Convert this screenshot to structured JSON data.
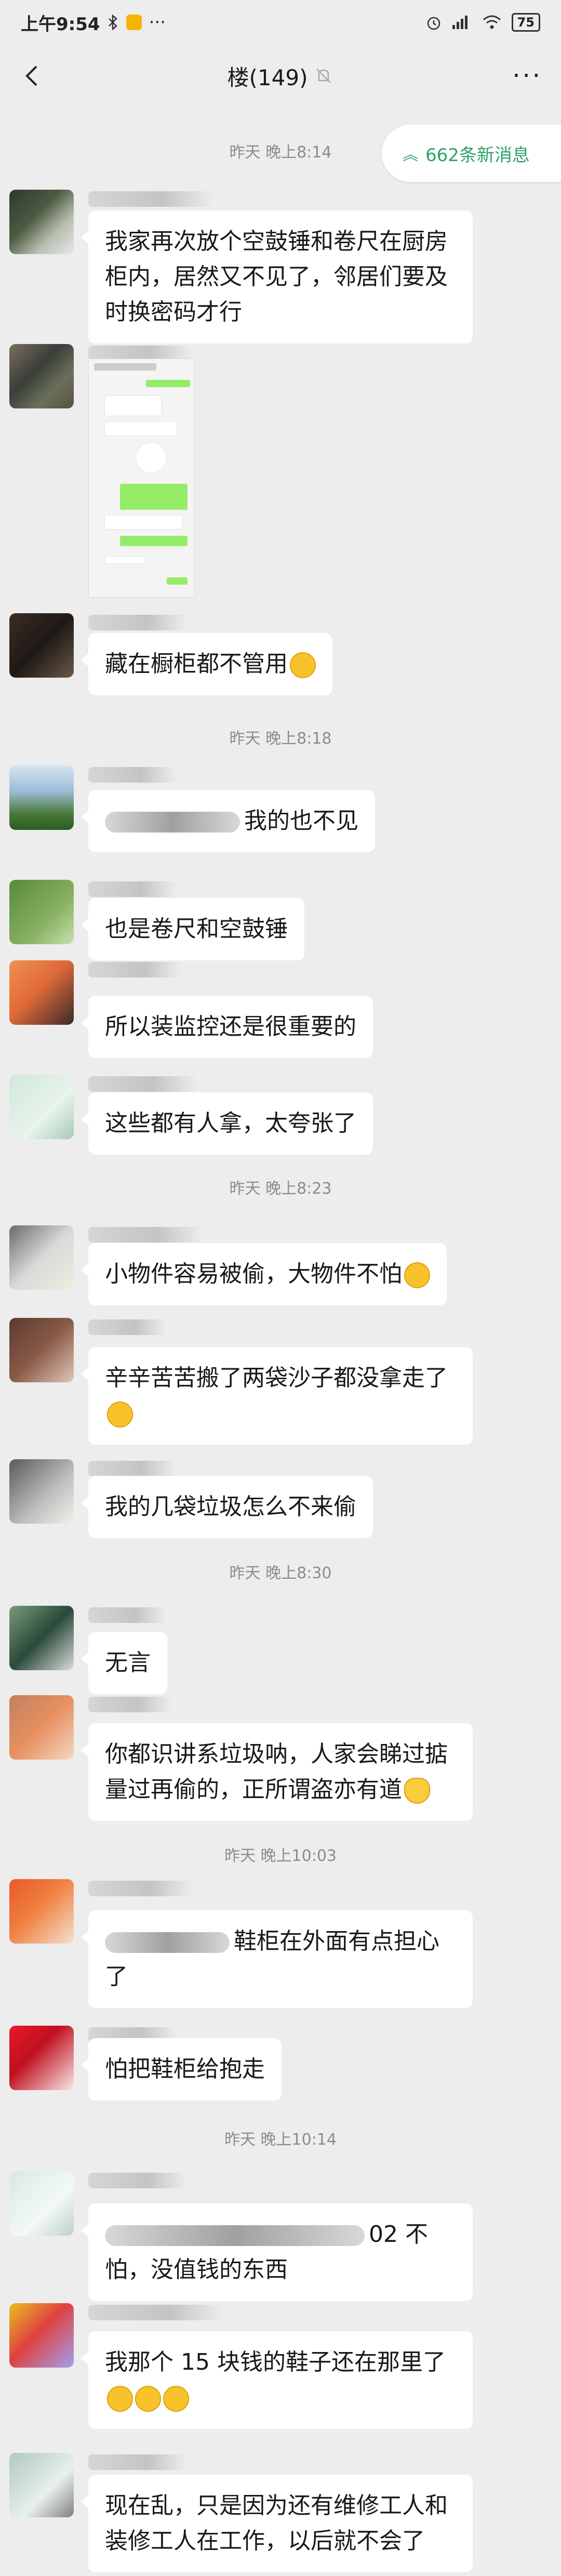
{
  "status_bar": {
    "time": "上午9:54",
    "battery": "75"
  },
  "header": {
    "title": "楼(149)",
    "more": "···"
  },
  "new_messages": "662条新消息",
  "timestamps": {
    "t1": "昨天 晚上8:14",
    "t2": "昨天 晚上8:18",
    "t3": "昨天 晚上8:23",
    "t4": "昨天 晚上8:30",
    "t5": "昨天 晚上10:03",
    "t6": "昨天 晚上10:14"
  },
  "messages": {
    "m1": "我家再次放个空鼓锤和卷尺在厨房柜内，居然又不见了，邻居们要及时换密码才行",
    "m2": "藏在橱柜都不管用",
    "m3": "我的也不见",
    "m4": "也是卷尺和空鼓锤",
    "m5": "所以装监控还是很重要的",
    "m6": "这些都有人拿，太夸张了",
    "m7": "小物件容易被偷，大物件不怕",
    "m8": "辛辛苦苦搬了两袋沙子都没拿走了",
    "m9": "我的几袋垃圾怎么不来偷",
    "m10": "无言",
    "m11": "你都识讲系垃圾呐，人家会睇过掂量过再偷的，正所谓盗亦有道",
    "m12": "鞋柜在外面有点担心了",
    "m13": "怕把鞋柜给抱走",
    "m14a": "02 不",
    "m14b": "怕，没值钱的东西",
    "m15": "我那个 15 块钱的鞋子还在那里了",
    "m16": "现在乱，只是因为还有维修工人和装修工人在工作，以后就不会了"
  },
  "colors": {
    "bg": "#ededed",
    "bubble": "#ffffff",
    "accent": "#2fa366",
    "emoji": "#f8c22a"
  }
}
